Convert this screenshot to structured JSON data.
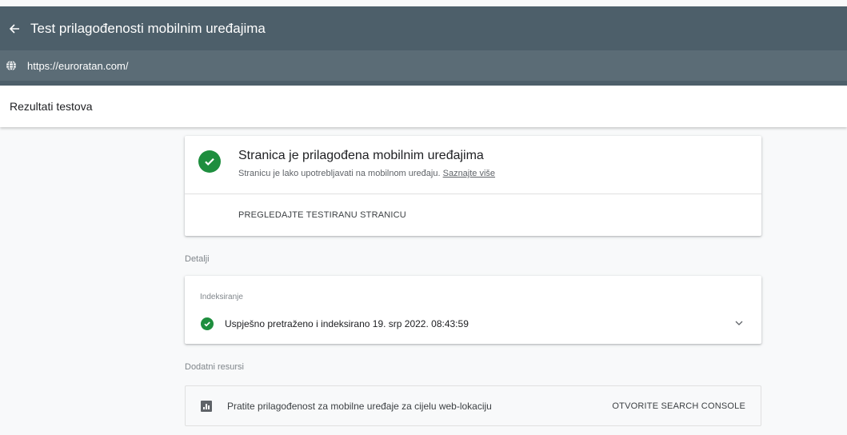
{
  "app": {
    "title": "Test prilagođenosti mobilnim uređajima"
  },
  "url": "https://euroratan.com/",
  "subheader": {
    "title": "Rezultati testova"
  },
  "status": {
    "title": "Stranica je prilagođena mobilnim uređajima",
    "subtitle": "Stranicu je lako upotrebljavati na mobilnom uređaju.",
    "learn_more": "Saznajte više",
    "action": "PREGLEDAJTE TESTIRANU STRANICU"
  },
  "details": {
    "label": "Detalji",
    "indexing": {
      "label": "Indeksiranje",
      "status": "Uspješno pretraženo i indeksirano 19. srp 2022. 08:43:59"
    }
  },
  "resources": {
    "label": "Dodatni resursi",
    "text": "Pratite prilagođenost za mobilne uređaje za cijelu web-lokaciju",
    "action": "OTVORITE SEARCH CONSOLE"
  },
  "colors": {
    "topbar": "#4d5f6a",
    "urlbar": "#5b6c76",
    "success": "#1e8e3e"
  },
  "icons": [
    "back-arrow-icon",
    "globe-icon",
    "check-circle-icon",
    "chevron-down-icon",
    "bar-chart-icon"
  ]
}
